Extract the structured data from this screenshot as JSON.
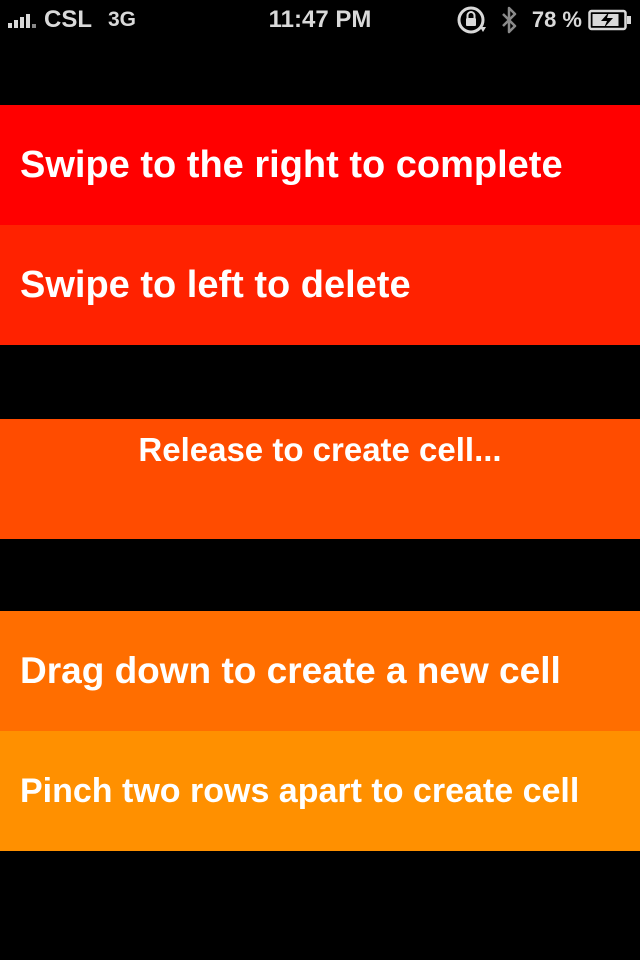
{
  "status_bar": {
    "carrier": "CSL",
    "network": "3G",
    "time": "11:47 PM",
    "battery": "78 %",
    "icons": [
      "signal-icon",
      "orientation-lock-icon",
      "bluetooth-icon",
      "battery-charging-icon"
    ]
  },
  "rows": [
    {
      "label": "Swipe to the right to complete",
      "color": "#ff0000"
    },
    {
      "label": "Swipe to left to delete",
      "color": "#ff2200"
    },
    {
      "label": "Release to create cell...",
      "color": "#ff4c00"
    },
    {
      "label": "Drag down to create a new cell",
      "color": "#ff6e00"
    },
    {
      "label": "Pinch two rows apart to create cell",
      "color": "#ff9000"
    }
  ]
}
